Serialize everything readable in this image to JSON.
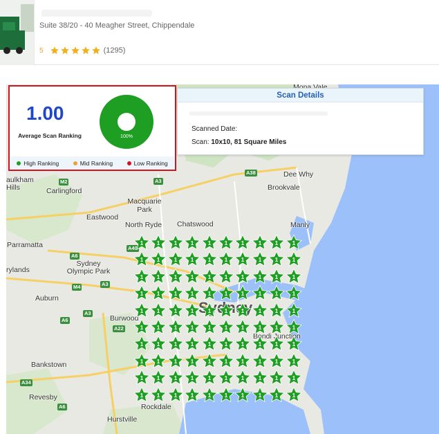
{
  "business": {
    "address": "Suite 38/20 - 40 Meagher Street, Chippendale",
    "rating_value": "5",
    "rating_stars": 5,
    "review_count": "(1295)"
  },
  "ranking_summary": {
    "average_value": "1.00",
    "average_label": "Average Scan Ranking",
    "donut_percent": 100,
    "donut_label": "100%",
    "legend": [
      {
        "label": "High Ranking",
        "color": "#1e9e22"
      },
      {
        "label": "Mid Ranking",
        "color": "#e8a33b"
      },
      {
        "label": "Low Ranking",
        "color": "#d3131e"
      }
    ]
  },
  "scan_details": {
    "title": "Scan Details",
    "date_label": "Scanned Date:",
    "area_label": "Scan:",
    "area_value": "10x10, 81 Square Miles"
  },
  "map": {
    "places": [
      "Mona Vale",
      "Dee Why",
      "Brookvale",
      "aulkham Hills",
      "Carlingford",
      "Macquarie Park",
      "Eastwood",
      "North Ryde",
      "Chatswood",
      "Manly",
      "Parramatta",
      "Sydney Olympic Park",
      "rylands",
      "Auburn",
      "Burwood",
      "Bondi Junction",
      "Bankstown",
      "Revesby",
      "Rockdale",
      "Hurstville",
      "Sydney"
    ],
    "road_labels": [
      "A38",
      "M2",
      "A3",
      "A40",
      "A6",
      "M4",
      "A3",
      "A6",
      "A22",
      "A3",
      "A34",
      "A6"
    ]
  },
  "grid": {
    "rows": 10,
    "cols": 10,
    "rank_label": "1",
    "pin_color": "#1e9e22"
  },
  "colors": {
    "accent": "#1f48c9",
    "highlight_border": "#d3131e",
    "star": "#f2b01e"
  }
}
